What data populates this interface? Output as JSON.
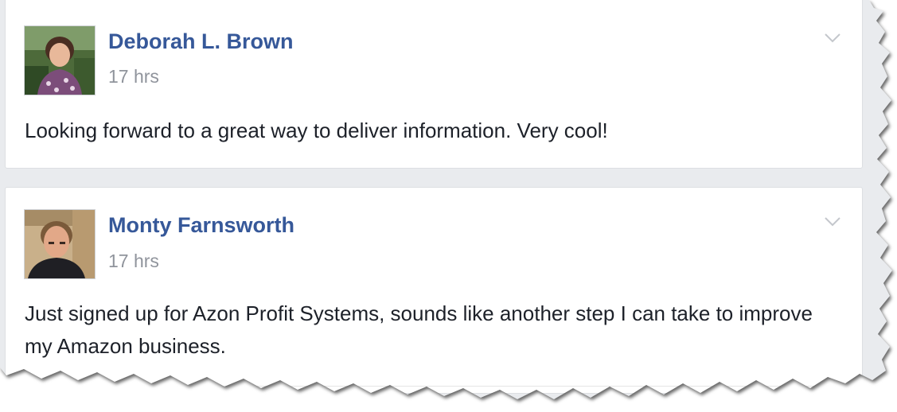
{
  "posts": [
    {
      "author": "Deborah L. Brown",
      "time": "17 hrs",
      "text": "Looking forward to a great way to deliver information. Very cool!",
      "avatar_icon": "profile-photo"
    },
    {
      "author": "Monty Farnsworth",
      "time": "17 hrs",
      "text": "Just signed up for Azon Profit Systems, sounds like another step I can take to improve my Amazon business.",
      "avatar_icon": "profile-photo"
    }
  ],
  "colors": {
    "name_link": "#365899",
    "timestamp": "#90949c",
    "body_text": "#1d2129",
    "feed_background": "#e9ebee",
    "card_background": "#ffffff"
  }
}
